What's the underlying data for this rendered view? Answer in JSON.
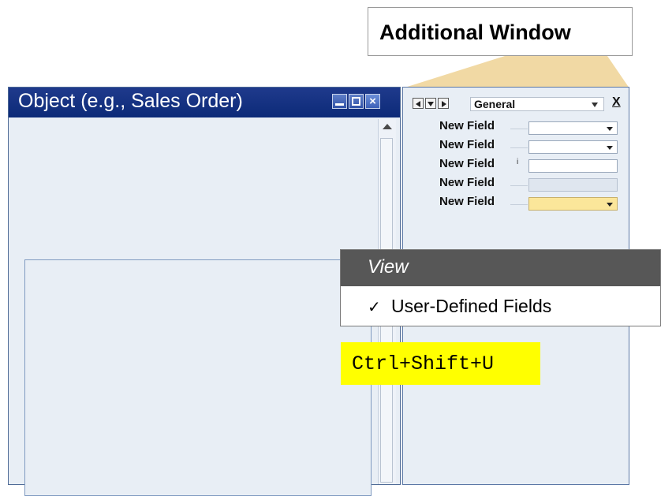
{
  "callout": {
    "title": "Additional Window"
  },
  "main_window": {
    "title": "Object (e.g., Sales Order)",
    "close_glyph": "×"
  },
  "side_window": {
    "tab_select": "General",
    "close_label": "X",
    "fields": [
      {
        "label": "New Field",
        "type": "dropdown"
      },
      {
        "label": "New Field",
        "type": "dropdown"
      },
      {
        "label": "New Field",
        "type": "text",
        "marker": "i"
      },
      {
        "label": "New Field",
        "type": "readonly"
      },
      {
        "label": "New Field",
        "type": "mandatory-dropdown"
      }
    ]
  },
  "view_menu": {
    "title": "View",
    "check": "✓",
    "item": "User-Defined Fields"
  },
  "shortcut": {
    "keys": "Ctrl+Shift+U"
  },
  "colors": {
    "title_bar": "#1f3a8c",
    "window_bg": "#e8eef5",
    "callout_pointer": "#f1d9a4",
    "menu_header": "#575757",
    "shortcut_highlight": "#ffff00",
    "mandatory_field": "#fbe69a"
  }
}
